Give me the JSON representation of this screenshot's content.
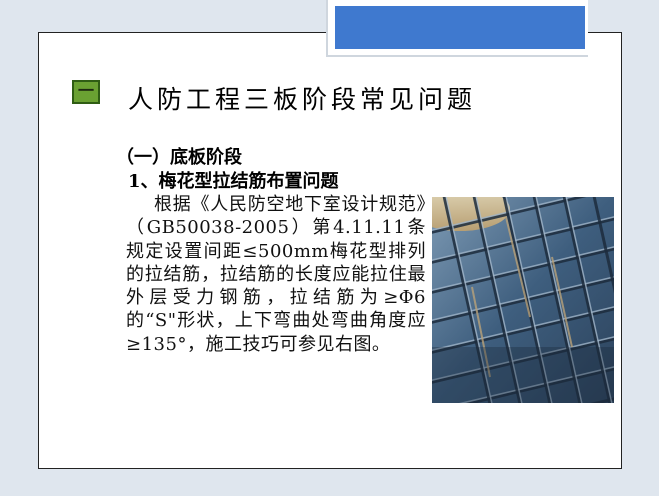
{
  "slide": {
    "section_number": "一",
    "title": "人防工程三板阶段常见问题",
    "subheading": "（一）底板阶段",
    "item_heading": "1、梅花型拉结筋布置问题",
    "body": "根据《人民防空地下室设计规范》（GB50038-2005）第4.11.11条规定设置间距≤500mm梅花型排列的拉结筋，拉结筋的长度应能拉住最外层受力钢筋，拉结筋为≥Φ6的“S\"形状，上下弯曲处弯曲角度应≥135°，施工技巧可参见右图。"
  },
  "colors": {
    "accent_blue": "#3f79cf",
    "marker_green": "#6aa132",
    "background": "#dfe6ee"
  },
  "image": {
    "subject": "rebar-mesh-photo"
  }
}
